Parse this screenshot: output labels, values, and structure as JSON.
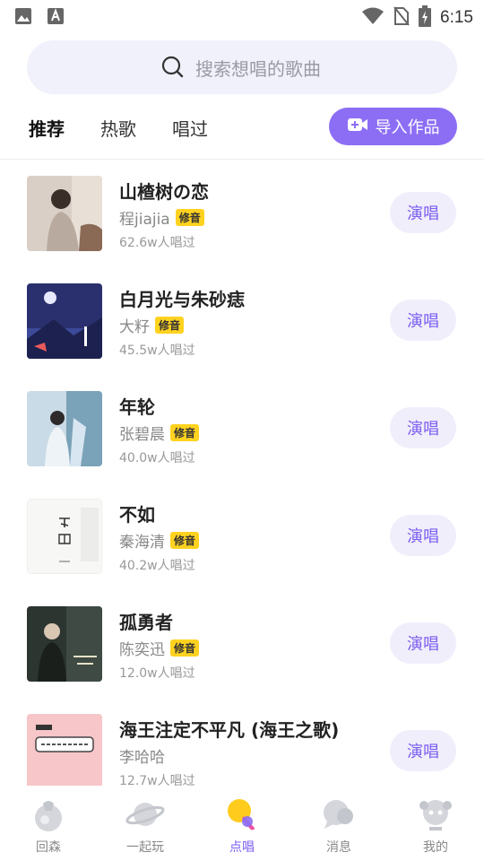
{
  "status_bar": {
    "time": "6:15"
  },
  "search": {
    "placeholder": "搜索想唱的歌曲"
  },
  "tabs": [
    {
      "label": "推荐",
      "active": true
    },
    {
      "label": "热歌",
      "active": false
    },
    {
      "label": "唱过",
      "active": false
    }
  ],
  "import_button": {
    "label": "导入作品"
  },
  "sing_label": "演唱",
  "songs": [
    {
      "title": "山楂树の恋",
      "artist": "程jiajia",
      "badge": "修音",
      "count": "62.6w人唱过"
    },
    {
      "title": "白月光与朱砂痣",
      "artist": "大籽",
      "badge": "修音",
      "count": "45.5w人唱过"
    },
    {
      "title": "年轮",
      "artist": "张碧晨",
      "badge": "修音",
      "count": "40.0w人唱过"
    },
    {
      "title": "不如",
      "artist": "秦海清",
      "badge": "修音",
      "count": "40.2w人唱过"
    },
    {
      "title": "孤勇者",
      "artist": "陈奕迅",
      "badge": "修音",
      "count": "12.0w人唱过"
    },
    {
      "title": "海王注定不平凡 (海王之歌)",
      "artist": "李哈哈",
      "count": "12.7w人唱过"
    }
  ],
  "bottom_nav": [
    {
      "label": "回森",
      "icon": "home-icon"
    },
    {
      "label": "一起玩",
      "icon": "planet-icon"
    },
    {
      "label": "点唱",
      "icon": "microphone-icon",
      "active": true
    },
    {
      "label": "消息",
      "icon": "message-icon"
    },
    {
      "label": "我的",
      "icon": "profile-icon"
    }
  ],
  "colors": {
    "accent": "#8c6ef5",
    "badge": "#ffd21f",
    "search_bg": "#f1f1fb"
  }
}
